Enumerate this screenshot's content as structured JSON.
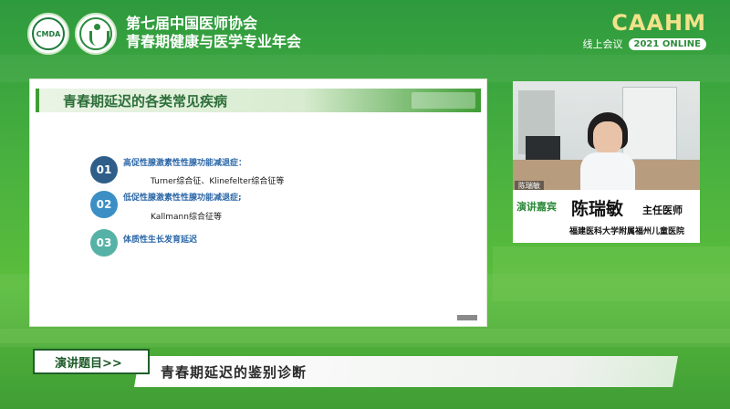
{
  "header": {
    "logo_left_text": "CMDA",
    "title_line1": "第七届中国医师协会",
    "title_line2": "青春期健康与医学专业年会",
    "brand_mark": "CAAHM",
    "online_label": "线上会议",
    "year_badge": "2021 ONLINE"
  },
  "slide": {
    "title": "青春期延迟的各类常见疾病",
    "items": [
      {
        "num": "01",
        "title": "高促性腺激素性性腺功能减退症：",
        "detail": "Turner综合征、Klinefelter综合征等"
      },
      {
        "num": "02",
        "title": "低促性腺激素性性腺功能减退症;",
        "detail": "Kallmann综合征等"
      },
      {
        "num": "03",
        "title": "体质性生长发育延迟",
        "detail": ""
      }
    ]
  },
  "speaker": {
    "video_tag": "陈瑞敏",
    "role": "演讲嘉宾",
    "name": "陈瑞敏",
    "position": "主任医师",
    "organization": "福建医科大学附属福州儿童医院"
  },
  "topic": {
    "label": "演讲题目>>",
    "text": "青春期延迟的鉴别诊断"
  },
  "colors": {
    "background": "#49b13f",
    "slide_heading": "#2d6f3a",
    "item_title": "#2b67a8",
    "num1": "#2f5e8a",
    "num2": "#3b8fc4",
    "num3": "#56b2a6"
  }
}
